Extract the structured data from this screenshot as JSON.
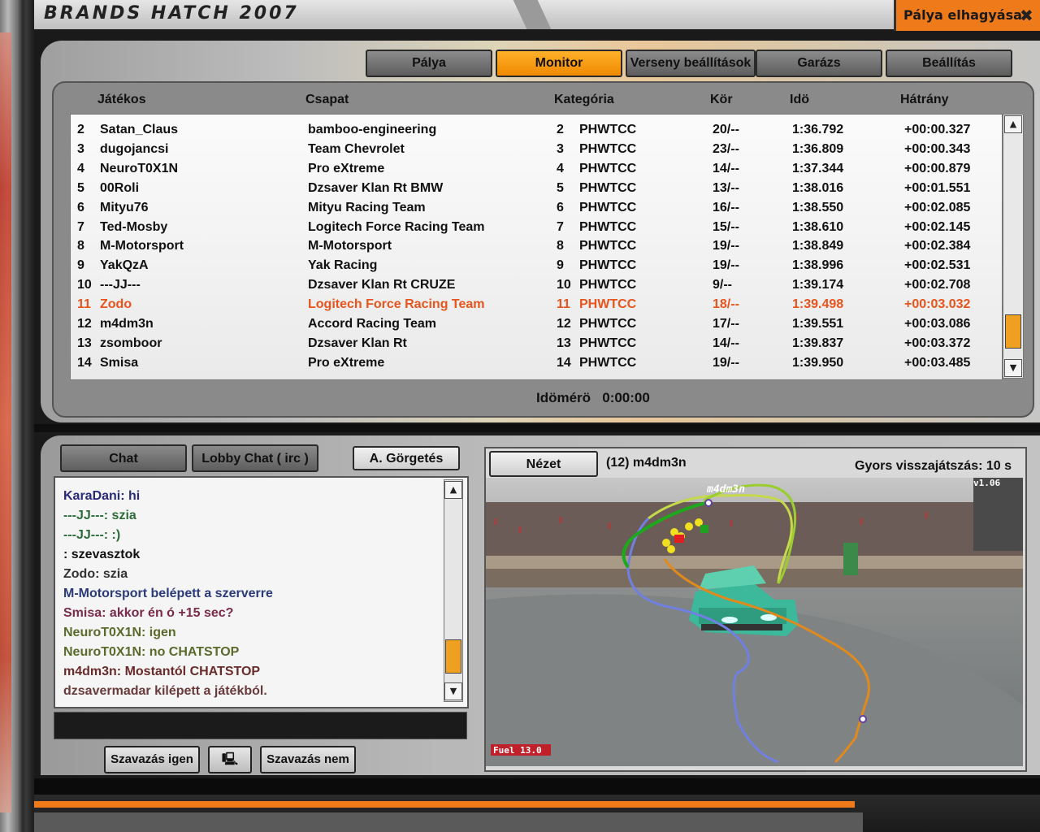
{
  "title": "BRANDS HATCH 2007",
  "exit_label": "Pálya elhagyása",
  "tabs": [
    {
      "label": "Pálya",
      "active": false
    },
    {
      "label": "Monitor",
      "active": true
    },
    {
      "label": "Verseny beállítások",
      "active": false
    },
    {
      "label": "Garázs",
      "active": false
    },
    {
      "label": "Beállítás",
      "active": false
    }
  ],
  "table": {
    "headers": {
      "player": "Játékos",
      "team": "Csapat",
      "category": "Kategória",
      "lap": "Kör",
      "time": "Idö",
      "gap": "Hátrány"
    },
    "rows": [
      {
        "pos": "2",
        "player": "Satan_Claus",
        "team": "bamboo-engineering",
        "num": "2",
        "cat": "PHWTCC",
        "lap": "20/--",
        "time": "1:36.792",
        "gap": "+00:00.327"
      },
      {
        "pos": "3",
        "player": "dugojancsi",
        "team": "Team Chevrolet",
        "num": "3",
        "cat": "PHWTCC",
        "lap": "23/--",
        "time": "1:36.809",
        "gap": "+00:00.343"
      },
      {
        "pos": "4",
        "player": "NeuroT0X1N",
        "team": "Pro eXtreme",
        "num": "4",
        "cat": "PHWTCC",
        "lap": "14/--",
        "time": "1:37.344",
        "gap": "+00:00.879"
      },
      {
        "pos": "5",
        "player": "00Roli",
        "team": "Dzsaver Klan Rt BMW",
        "num": "5",
        "cat": "PHWTCC",
        "lap": "13/--",
        "time": "1:38.016",
        "gap": "+00:01.551"
      },
      {
        "pos": "6",
        "player": "Mityu76",
        "team": "Mityu Racing Team",
        "num": "6",
        "cat": "PHWTCC",
        "lap": "16/--",
        "time": "1:38.550",
        "gap": "+00:02.085"
      },
      {
        "pos": "7",
        "player": "Ted-Mosby",
        "team": "Logitech Force Racing Team",
        "num": "7",
        "cat": "PHWTCC",
        "lap": "15/--",
        "time": "1:38.610",
        "gap": "+00:02.145"
      },
      {
        "pos": "8",
        "player": "M-Motorsport",
        "team": "M-Motorsport",
        "num": "8",
        "cat": "PHWTCC",
        "lap": "19/--",
        "time": "1:38.849",
        "gap": "+00:02.384"
      },
      {
        "pos": "9",
        "player": "YakQzA",
        "team": "Yak Racing",
        "num": "9",
        "cat": "PHWTCC",
        "lap": "19/--",
        "time": "1:38.996",
        "gap": "+00:02.531"
      },
      {
        "pos": "10",
        "player": "---JJ---",
        "team": "Dzsaver Klan Rt CRUZE",
        "num": "10",
        "cat": "PHWTCC",
        "lap": "9/--",
        "time": "1:39.174",
        "gap": "+00:02.708"
      },
      {
        "pos": "11",
        "player": "Zodo",
        "team": "Logitech Force Racing Team",
        "num": "11",
        "cat": "PHWTCC",
        "lap": "18/--",
        "time": "1:39.498",
        "gap": "+00:03.032",
        "highlight": true
      },
      {
        "pos": "12",
        "player": "m4dm3n",
        "team": "Accord Racing Team",
        "num": "12",
        "cat": "PHWTCC",
        "lap": "17/--",
        "time": "1:39.551",
        "gap": "+00:03.086"
      },
      {
        "pos": "13",
        "player": "zsomboor",
        "team": "Dzsaver Klan Rt",
        "num": "13",
        "cat": "PHWTCC",
        "lap": "14/--",
        "time": "1:39.837",
        "gap": "+00:03.372"
      },
      {
        "pos": "14",
        "player": "Smisa",
        "team": "Pro eXtreme",
        "num": "14",
        "cat": "PHWTCC",
        "lap": "19/--",
        "time": "1:39.950",
        "gap": "+00:03.485"
      }
    ]
  },
  "timer": {
    "label": "Idömérö",
    "value": "0:00:00"
  },
  "chat": {
    "tabs": {
      "chat": "Chat",
      "lobby": "Lobby Chat ( irc )",
      "autoscroll": "A. Görgetés"
    },
    "messages": [
      {
        "text": "KaraDani: hi",
        "color": "#2a2a7a"
      },
      {
        "text": "---JJ---: szia",
        "color": "#2e6b3a"
      },
      {
        "text": "---JJ---: :)",
        "color": "#2e6b3a"
      },
      {
        "text": ": szevasztok",
        "color": "#111111"
      },
      {
        "text": "Zodo: szia",
        "color": "#333333"
      },
      {
        "text": "M-Motorsport belépett a szerverre",
        "color": "#2a3a7a"
      },
      {
        "text": "Smisa: akkor én ó +15 sec?",
        "color": "#7a2a4a"
      },
      {
        "text": "NeuroT0X1N: igen",
        "color": "#5a6a2a"
      },
      {
        "text": "NeuroT0X1N: no CHATSTOP",
        "color": "#5a6a2a"
      },
      {
        "text": "m4dm3n: Mostantól CHATSTOP",
        "color": "#6a2a2a"
      },
      {
        "text": "dzsavermadar kilépett a játékból.",
        "color": "#6a3a3a"
      }
    ],
    "vote_yes": "Szavazás igen",
    "vote_no": "Szavazás nem"
  },
  "view": {
    "button": "Nézet",
    "driver": "(12) m4dm3n",
    "replay": "Gyors visszajátszás: 10 s",
    "map_label": "m4dm3n",
    "version": "v1.06",
    "fuel": "Fuel 13.0"
  }
}
